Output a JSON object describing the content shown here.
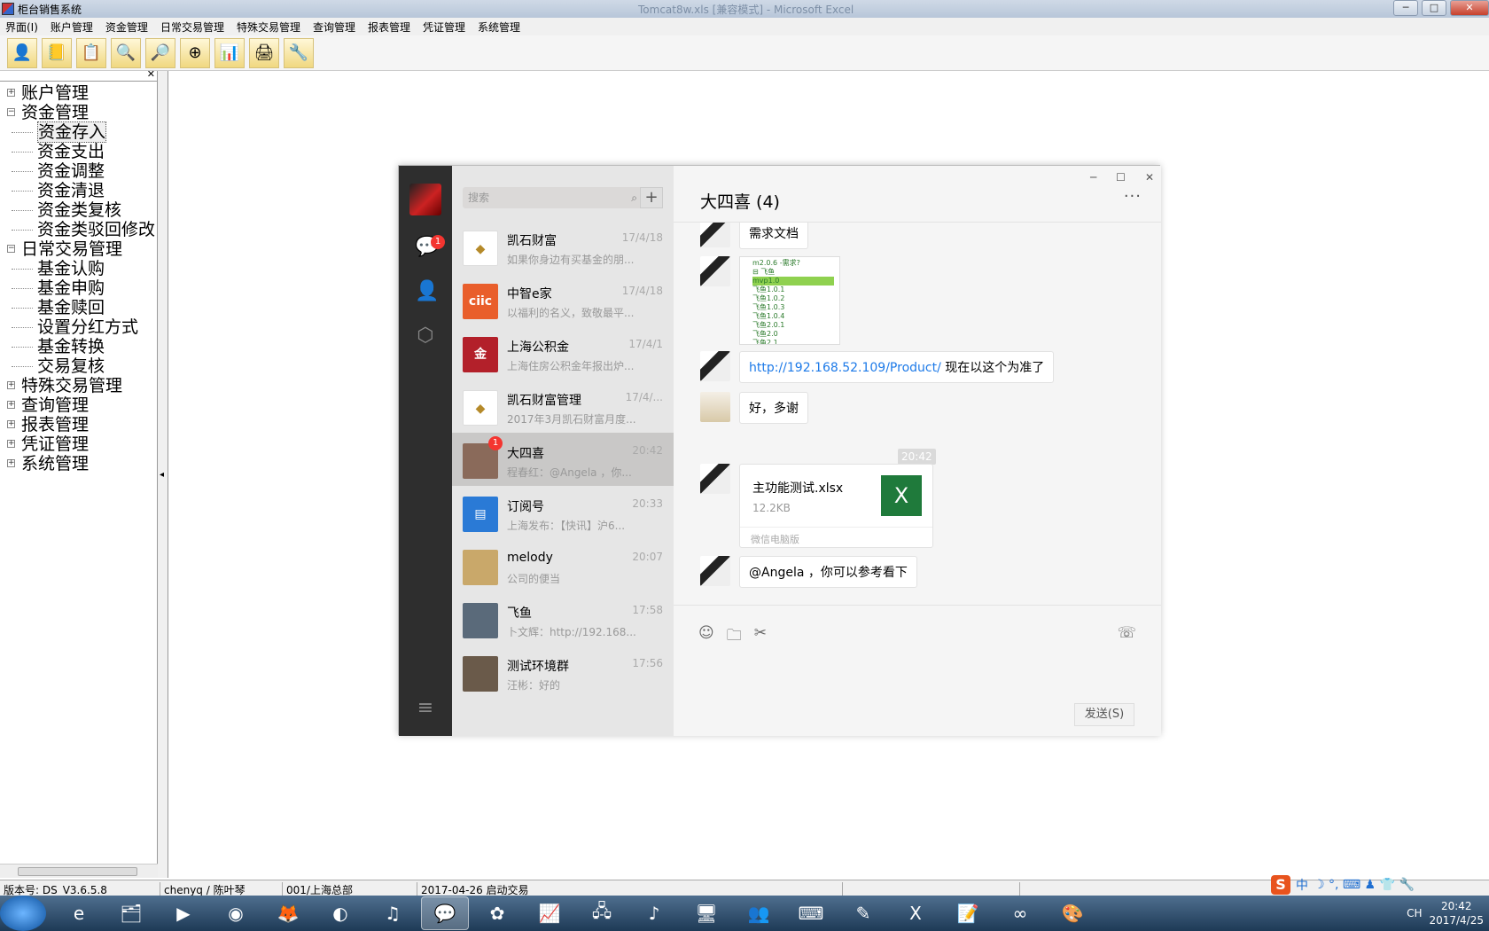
{
  "app": {
    "title": "柜台销售系统",
    "ghost_title": "Tomcat8w.xls   [兼容模式] - Microsoft Excel",
    "win_min": "─",
    "win_max": "□",
    "win_close": "✕"
  },
  "menu": [
    "界面(I)",
    "账户管理",
    "资金管理",
    "日常交易管理",
    "特殊交易管理",
    "查询管理",
    "报表管理",
    "凭证管理",
    "系统管理"
  ],
  "toolbar": [
    "user-icon",
    "book-icon",
    "note-icon",
    "search-person-icon",
    "magnifier-icon",
    "zoom-icon",
    "chart-icon",
    "printer-icon",
    "tools-icon"
  ],
  "left_panel": {
    "close": "✕",
    "tree": [
      {
        "label": "账户管理",
        "level": 0,
        "expander": "+"
      },
      {
        "label": "资金管理",
        "level": 0,
        "expander": "−"
      },
      {
        "label": "资金存入",
        "level": 1,
        "selected": true
      },
      {
        "label": "资金支出",
        "level": 1
      },
      {
        "label": "资金调整",
        "level": 1
      },
      {
        "label": "资金清退",
        "level": 1
      },
      {
        "label": "资金类复核",
        "level": 1
      },
      {
        "label": "资金类驳回修改",
        "level": 1
      },
      {
        "label": "日常交易管理",
        "level": 0,
        "expander": "−"
      },
      {
        "label": "基金认购",
        "level": 1
      },
      {
        "label": "基金申购",
        "level": 1
      },
      {
        "label": "基金赎回",
        "level": 1
      },
      {
        "label": "设置分红方式",
        "level": 1
      },
      {
        "label": "基金转换",
        "level": 1
      },
      {
        "label": "交易复核",
        "level": 1
      },
      {
        "label": "特殊交易管理",
        "level": 0,
        "expander": "+"
      },
      {
        "label": "查询管理",
        "level": 0,
        "expander": "+"
      },
      {
        "label": "报表管理",
        "level": 0,
        "expander": "+"
      },
      {
        "label": "凭证管理",
        "level": 0,
        "expander": "+"
      },
      {
        "label": "系统管理",
        "level": 0,
        "expander": "+"
      }
    ]
  },
  "status": {
    "version": "版本号: DS_V3.6.5.8",
    "user": "chenyq / 陈叶琴",
    "branch": "001/上海总部",
    "date": "2017-04-26 启动交易"
  },
  "ime": {
    "logo": "S",
    "lang": "中",
    "icons": "☽ °, ⌨ ♟ 👕 🔧"
  },
  "taskbar": {
    "items": [
      "ie-icon",
      "folder-icon",
      "media-icon",
      "chrome-icon",
      "firefox-icon",
      "qq-browser-icon",
      "netease-icon",
      "wechat-icon",
      "baidu-icon",
      "chart-app-icon",
      "network-icon",
      "music-icon",
      "terminal-icon",
      "people-icon",
      "cmd-icon",
      "pen-icon",
      "excel-icon",
      "notepad-icon",
      "vs-icon",
      "paint-icon"
    ],
    "tray_lang": "CH",
    "time": "20:42",
    "date": "2017/4/25"
  },
  "wechat": {
    "search_placeholder": "搜索",
    "add": "+",
    "nav_badge": "1",
    "chat_title": "大四喜 (4)",
    "more": "···",
    "win_min": "─",
    "win_max": "☐",
    "win_close": "✕",
    "conversations": [
      {
        "name": "凯石财富",
        "time": "17/4/18",
        "preview": "如果你身边有买基金的朋...",
        "avatar_color": "#ffffff",
        "avatar_text": "◆"
      },
      {
        "name": "中智e家",
        "time": "17/4/18",
        "preview": "以福利的名义，致敬最平...",
        "avatar_color": "#e95e2b",
        "avatar_text": "ciic"
      },
      {
        "name": "上海公积金",
        "time": "17/4/1",
        "preview": "上海住房公积金年报出炉...",
        "avatar_color": "#b3202a",
        "avatar_text": "金"
      },
      {
        "name": "凯石财富管理",
        "time": "17/4/...",
        "preview": "2017年3月凯石财富月度...",
        "avatar_color": "#ffffff",
        "avatar_text": "◆"
      },
      {
        "name": "大四喜",
        "time": "20:42",
        "preview": "程春红：@Angela ，你...",
        "avatar_color": "#8a6a5a",
        "avatar_text": "",
        "badge": "1",
        "selected": true
      },
      {
        "name": "订阅号",
        "time": "20:33",
        "preview": "上海发布：【快讯】沪6...",
        "avatar_color": "#2a7ad6",
        "avatar_text": "▤"
      },
      {
        "name": "melody",
        "time": "20:07",
        "preview": "公司的便当",
        "avatar_color": "#c9a86a",
        "avatar_text": ""
      },
      {
        "name": "飞鱼",
        "time": "17:58",
        "preview": "卜文辉：http://192.168....",
        "avatar_color": "#5a6a7a",
        "avatar_text": ""
      },
      {
        "name": "测试环境群",
        "time": "17:56",
        "preview": "汪彬：好的",
        "avatar_color": "#6a5a4a",
        "avatar_text": ""
      }
    ],
    "messages": {
      "m1": "需求文档",
      "thumb_lines": [
        "m2.0.6 -需求?",
        "⊟ 飞鱼",
        "mvp1.0",
        "飞鱼1.0.1",
        "飞鱼1.0.2",
        "飞鱼1.0.3",
        "飞鱼1.0.4",
        "飞鱼2.0.1",
        "飞鱼2.0",
        "飞鱼2.1"
      ],
      "link": "http://192.168.52.109/Product/",
      "link_suffix": " 现在以这个为准了",
      "m3": "好，多谢",
      "time_sep": "20:42",
      "file_name": "主功能测试.xlsx",
      "file_size": "12.2KB",
      "file_src": "微信电脑版",
      "file_icon": "X",
      "m5": "@Angela ，你可以参考看下"
    },
    "send": "发送(S)"
  }
}
